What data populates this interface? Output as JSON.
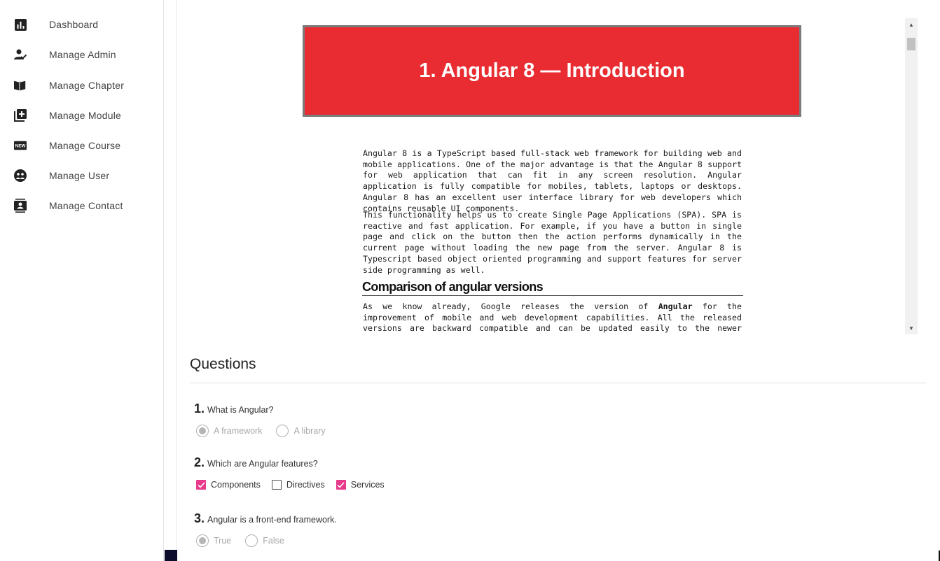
{
  "sidebar": {
    "items": [
      {
        "label": "Dashboard",
        "icon": "bar-chart-icon"
      },
      {
        "label": "Manage Admin",
        "icon": "person-check-icon"
      },
      {
        "label": "Manage Chapter",
        "icon": "book-open-icon"
      },
      {
        "label": "Manage Module",
        "icon": "add-library-icon"
      },
      {
        "label": "Manage Course",
        "icon": "new-badge-icon"
      },
      {
        "label": "Manage User",
        "icon": "group-icon"
      },
      {
        "label": "Manage Contact",
        "icon": "contact-card-icon"
      }
    ]
  },
  "document": {
    "banner_title": "1.   Angular 8 — Introduction",
    "paragraphs": [
      "Angular 8 is a TypeScript based full-stack web framework for building web and mobile applications. One of the major advantage is that the Angular 8 support for web application that can fit in any screen resolution. Angular application is fully compatible for mobiles, tablets, laptops or desktops. Angular 8 has an excellent user interface library for web developers which contains reusable UI components.",
      "This functionality helps us to create Single Page Applications (SPA). SPA is reactive and fast application. For example, if you have a button in single page and click on the button then the action performs dynamically in the current page without loading the new page from the server. Angular 8 is Typescript based object oriented programming and support features for server side programming as well."
    ],
    "heading": "Comparison of angular versions",
    "para3_before": "As we know already, Google releases the version of ",
    "para3_bold": "Angular",
    "para3_after": " for the improvement of mobile and web development capabilities. All the released versions are backward compatible and can be updated easily to the newer version. Let’s go through the"
  },
  "questions": {
    "title": "Questions",
    "items": [
      {
        "number": "1.",
        "text": "What is Angular?",
        "type": "radio",
        "options": [
          {
            "label": "A framework",
            "selected": true
          },
          {
            "label": "A library",
            "selected": false
          }
        ]
      },
      {
        "number": "2.",
        "text": "Which are Angular features?",
        "type": "checkbox",
        "options": [
          {
            "label": "Components",
            "checked": true
          },
          {
            "label": "Directives",
            "checked": false
          },
          {
            "label": "Services",
            "checked": true
          }
        ]
      },
      {
        "number": "3.",
        "text": "Angular is a front-end framework.",
        "type": "radio",
        "options": [
          {
            "label": "True",
            "selected": true
          },
          {
            "label": "False",
            "selected": false
          }
        ]
      }
    ]
  },
  "colors": {
    "banner": "#e82c31",
    "checkbox_accent": "#e8398a",
    "sidebar_icon": "#222222"
  }
}
